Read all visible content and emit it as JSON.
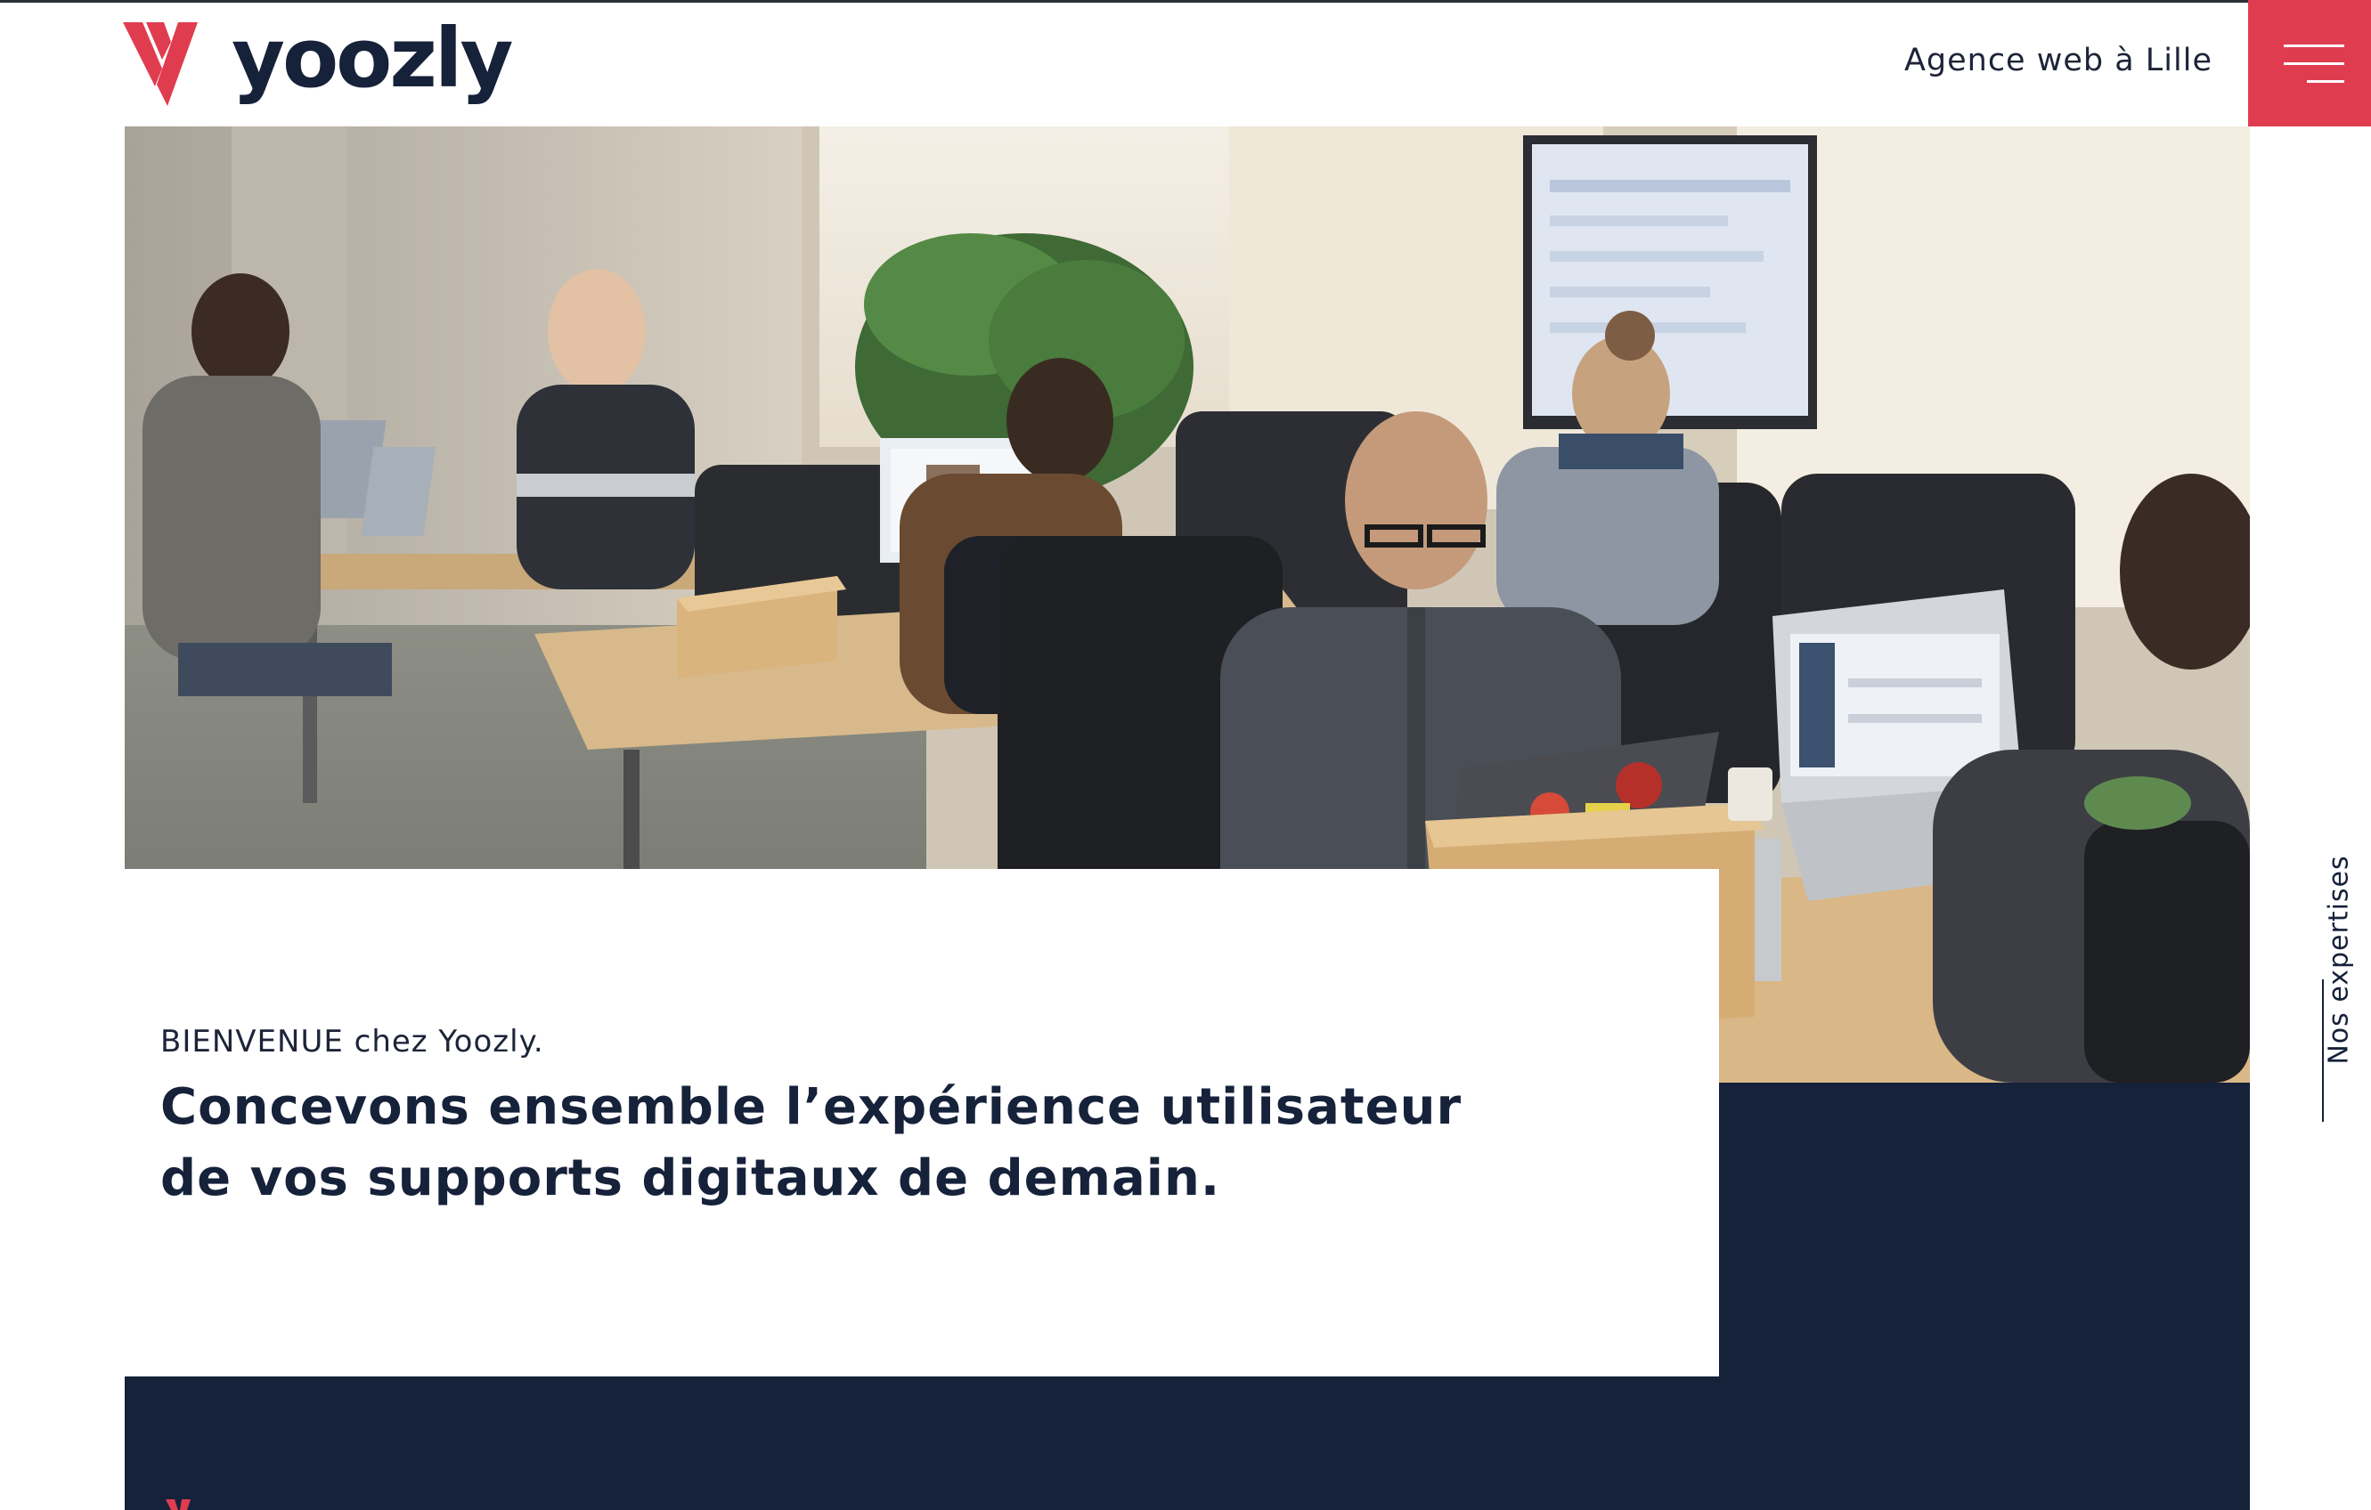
{
  "header": {
    "brand_name": "yoozly",
    "tagline": "Agence web à Lille",
    "menu_icon": "hamburger-menu-icon",
    "brand_color": "#e03c50",
    "dark_color": "#16213a"
  },
  "hero": {
    "image_subject": "team-working-in-office-photo",
    "welcome": "BIENVENUE chez Yoozly.",
    "headline": "Concevons ensemble l’expérience utilisateur de vos supports digitaux de demain."
  },
  "side_nav": {
    "label": "Nos expertises"
  }
}
